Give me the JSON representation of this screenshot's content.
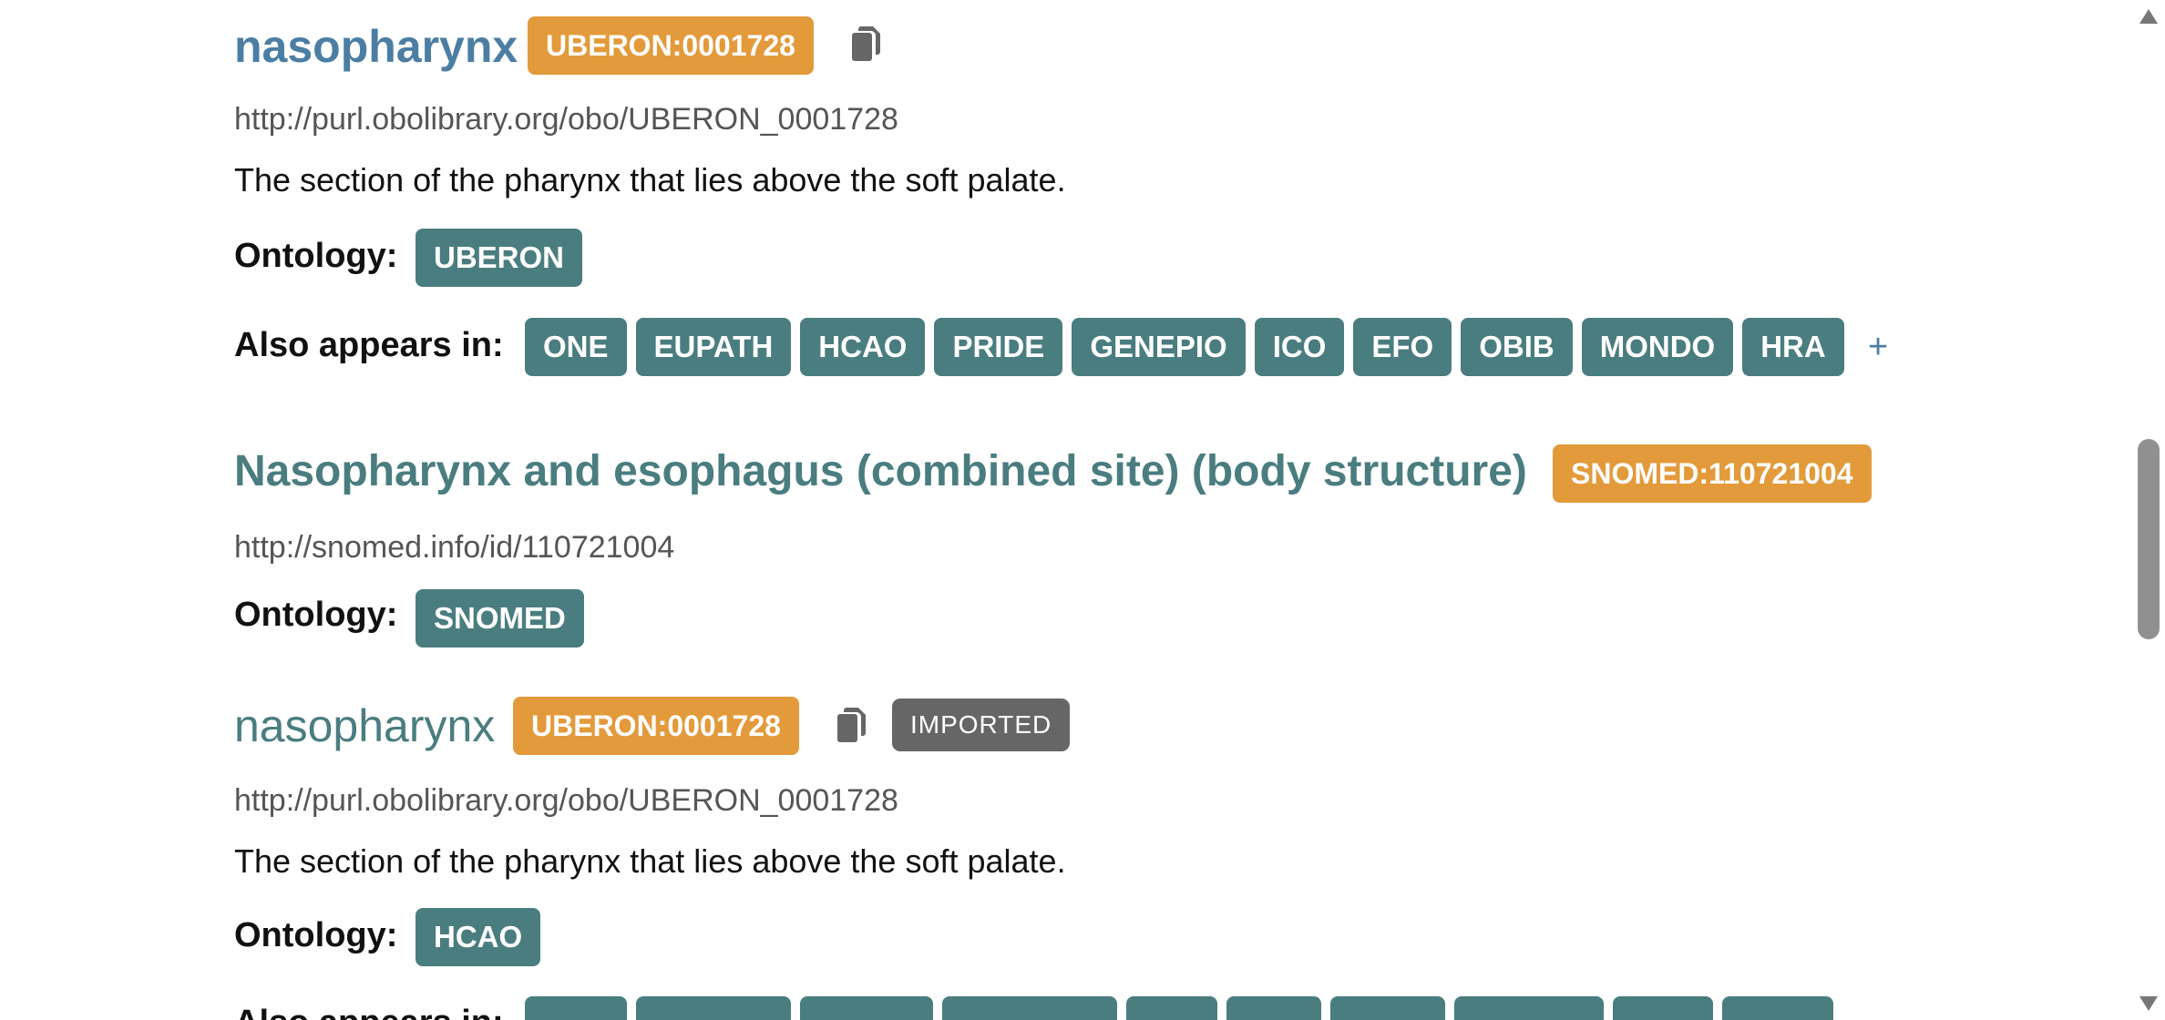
{
  "entries": [
    {
      "title": "nasopharynx",
      "curie": "UBERON:0001728",
      "url": "http://purl.obolibrary.org/obo/UBERON_0001728",
      "description": "The section of the pharynx that lies above the soft palate.",
      "ontology_label": "Ontology:",
      "ontology": "UBERON",
      "also_label": "Also appears in:",
      "also": [
        "ONE",
        "EUPATH",
        "HCAO",
        "PRIDE",
        "GENEPIO",
        "ICO",
        "EFO",
        "OBIB",
        "MONDO",
        "HRA"
      ],
      "more": "+",
      "icons": [
        "copy-icon"
      ]
    },
    {
      "title": "Nasopharynx and esophagus (combined site) (body structure)",
      "curie": "SNOMED:110721004",
      "url": "http://snomed.info/id/110721004",
      "ontology_label": "Ontology:",
      "ontology": "SNOMED"
    },
    {
      "title": "nasopharynx",
      "curie": "UBERON:0001728",
      "tag": "IMPORTED",
      "url": "http://purl.obolibrary.org/obo/UBERON_0001728",
      "description": "The section of the pharynx that lies above the soft palate.",
      "ontology_label": "Ontology:",
      "ontology": "HCAO",
      "also_label": "Also appears in:",
      "icons": [
        "copy-icon"
      ]
    }
  ],
  "colors": {
    "curie": "#e39a3a",
    "badge": "#4a7d7f",
    "title_primary": "#4c7ea3",
    "tag": "#666666"
  }
}
